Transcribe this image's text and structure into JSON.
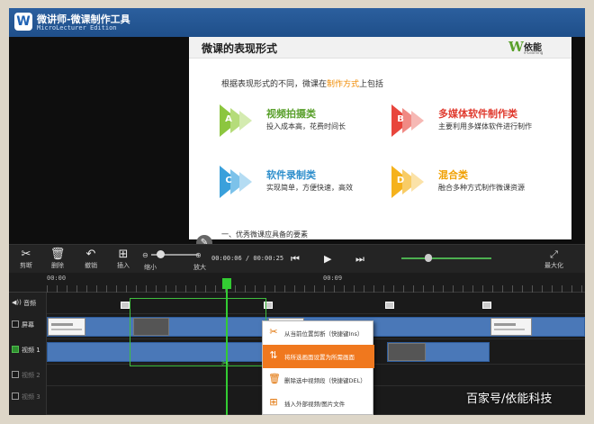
{
  "app": {
    "logo_letter": "W",
    "title": "微讲师-微课制作工具",
    "subtitle": "MicroLecturer Edition"
  },
  "slide": {
    "title": "微课的表现形式",
    "brand": {
      "mark": "W",
      "name": "依能",
      "sub": "e-Learning"
    },
    "intro_prefix": "根据表现形式的不同，微课在",
    "intro_highlight": "制作方式",
    "intro_suffix": "上包括",
    "categories": [
      {
        "letter": "A",
        "title": "视频拍摄类",
        "desc": "投入成本高，花费时间长",
        "color": "#8cc63f",
        "title_color": "#5aa02c"
      },
      {
        "letter": "B",
        "title": "多媒体软件制作类",
        "desc": "主要利用多媒体软件进行制作",
        "color": "#e8453c",
        "title_color": "#e03a2e"
      },
      {
        "letter": "C",
        "title": "软件录制类",
        "desc": "实现简单，方便快速，高效",
        "color": "#3aa0db",
        "title_color": "#2f8fcc"
      },
      {
        "letter": "D",
        "title": "混合类",
        "desc": "融合多种方式制作微课资源",
        "color": "#f5b21c",
        "title_color": "#f0a000"
      }
    ],
    "footer_text": "一、优秀微课应具备的要素",
    "pen_icon": "pen-icon"
  },
  "toolbar": {
    "tools": [
      {
        "name": "cut",
        "icon": "✂",
        "label": "剪断"
      },
      {
        "name": "delete",
        "icon": "🗑",
        "label": "删除"
      },
      {
        "name": "undo",
        "icon": "↶",
        "label": "撤销"
      },
      {
        "name": "insert",
        "icon": "⊞",
        "label": "插入"
      }
    ],
    "zoom_out_label": "缩小",
    "zoom_in_label": "放大",
    "zoom_minus": "⊖",
    "zoom_plus": "⊕",
    "zoom_level": 0.2,
    "time": "00:00:06 / 00:00:25",
    "prev": "⏮",
    "play": "▶",
    "next": "⏭",
    "volume": 0.3,
    "maximize_label": "最大化",
    "maximize_icon": "⤢"
  },
  "ruler": {
    "t0": "00:00",
    "t1": "00:09"
  },
  "tracks": [
    {
      "name": "音频",
      "prefix": "◀))",
      "checked": false,
      "dim": false
    },
    {
      "name": "屏幕",
      "checked": false,
      "dim": false
    },
    {
      "name": "视频 1",
      "checked": true,
      "dim": false
    },
    {
      "name": "视频 2",
      "checked": false,
      "dim": true
    },
    {
      "name": "视频 3",
      "checked": false,
      "dim": true
    }
  ],
  "context_menu": [
    {
      "icon": "✂",
      "label": "从当前位置剪断（快捷键Ins）",
      "highlighted": false
    },
    {
      "icon": "⇅",
      "label": "将所选画面设置为所需画面",
      "highlighted": true
    },
    {
      "icon": "🗑",
      "label": "删除选中视频段（快捷键DEL）",
      "highlighted": false
    },
    {
      "icon": "⊞",
      "label": "插入外部视频/图片文件",
      "highlighted": false
    }
  ],
  "watermark": "百家号/依能科技"
}
